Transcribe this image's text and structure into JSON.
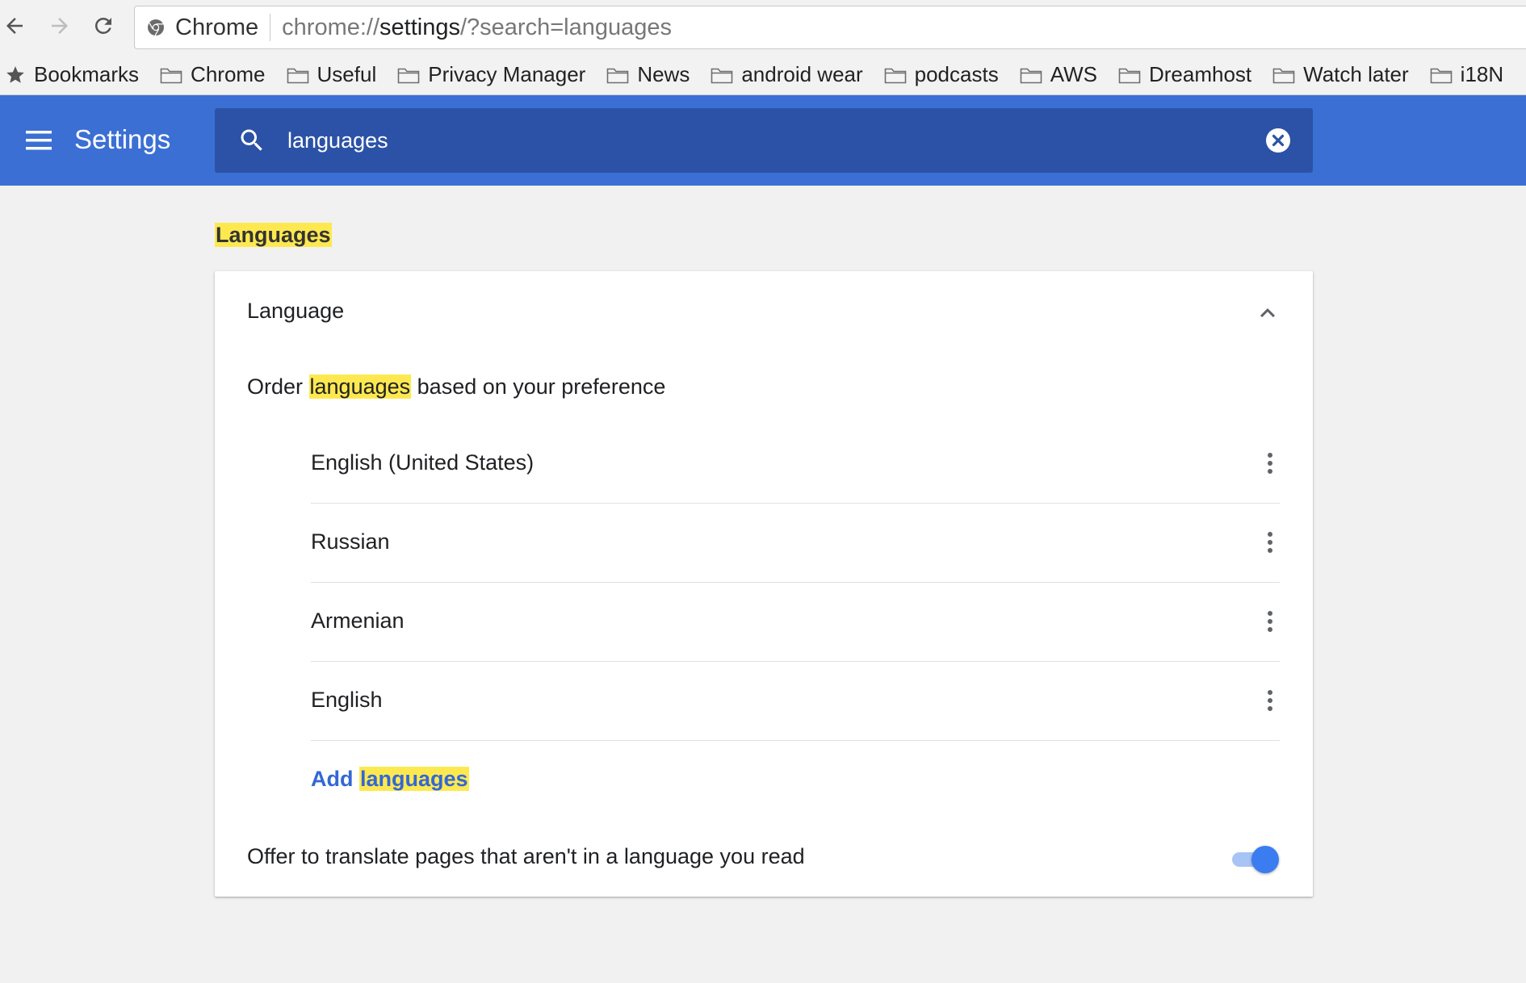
{
  "browser": {
    "omnibox_label": "Chrome",
    "url_prefix": "chrome://",
    "url_strong": "settings",
    "url_suffix": "/?search=languages"
  },
  "bookmarks": [
    {
      "label": "Bookmarks",
      "icon": "star-icon"
    },
    {
      "label": "Chrome",
      "icon": "folder-icon"
    },
    {
      "label": "Useful",
      "icon": "folder-icon"
    },
    {
      "label": "Privacy Manager",
      "icon": "folder-icon"
    },
    {
      "label": "News",
      "icon": "folder-icon"
    },
    {
      "label": "android wear",
      "icon": "folder-icon"
    },
    {
      "label": "podcasts",
      "icon": "folder-icon"
    },
    {
      "label": "AWS",
      "icon": "folder-icon"
    },
    {
      "label": "Dreamhost",
      "icon": "folder-icon"
    },
    {
      "label": "Watch later",
      "icon": "folder-icon"
    },
    {
      "label": "i18N",
      "icon": "folder-icon"
    }
  ],
  "header": {
    "title": "Settings",
    "search_value": "languages",
    "accent_color": "#3b6fd4"
  },
  "section": {
    "title": "Languages"
  },
  "card": {
    "header_label": "Language",
    "order_prefix": "Order ",
    "order_highlight": "languages",
    "order_suffix": " based on your preference",
    "languages": [
      "English (United States)",
      "Russian",
      "Armenian",
      "English"
    ],
    "add_prefix": "Add ",
    "add_highlight": "languages",
    "translate_label": "Offer to translate pages that aren't in a language you read",
    "translate_enabled": true
  },
  "colors": {
    "highlight": "#fde94f",
    "link": "#3367d6",
    "toggle_on": "#3b7df0"
  }
}
